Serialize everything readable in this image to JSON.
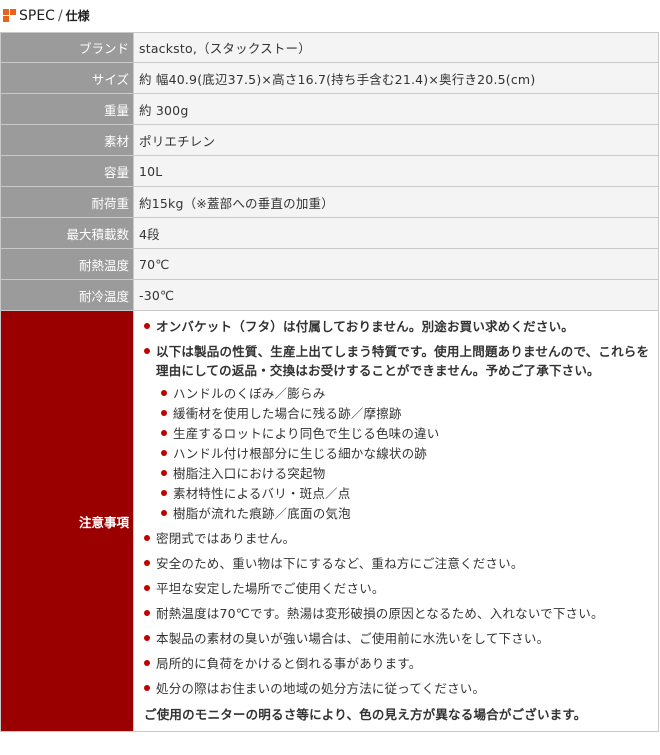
{
  "header": {
    "title": "SPEC",
    "title_ja": "仕様"
  },
  "spec_rows": [
    {
      "label": "ブランド",
      "value": "stacksto,（スタックストー）"
    },
    {
      "label": "サイズ",
      "value": "約 幅40.9(底辺37.5)×高さ16.7(持ち手含む21.4)×奥行き20.5(cm)"
    },
    {
      "label": "重量",
      "value": "約 300g"
    },
    {
      "label": "素材",
      "value": "ポリエチレン"
    },
    {
      "label": "容量",
      "value": "10L"
    },
    {
      "label": "耐荷重",
      "value": "約15kg（※蓋部への垂直の加重）"
    },
    {
      "label": "最大積載数",
      "value": "4段"
    },
    {
      "label": "耐熱温度",
      "value": "70℃"
    },
    {
      "label": "耐冷温度",
      "value": "-30℃"
    }
  ],
  "notice": {
    "label": "注意事項",
    "items": [
      "オンバケット（フタ）は付属しておりません。別途お買い求めください。",
      "以下は製品の性質、生産上出てしまう特質です。使用上問題ありませんので、これらを理由にしての返品・交換はお受けすることができません。予めご了承下さい。",
      "密閉式ではありません。",
      "安全のため、重い物は下にするなど、重ね方にご注意ください。",
      "平坦な安定した場所でご使用ください。",
      "耐熱温度は70℃です。熱湯は変形破損の原因となるため、入れないで下さい。",
      "本製品の素材の臭いが強い場合は、ご使用前に水洗いをして下さい。",
      "局所的に負荷をかけると倒れる事があります。",
      "処分の際はお住まいの地域の処分方法に従ってください。"
    ],
    "sub_items": [
      "ハンドルのくぼみ／膨らみ",
      "緩衝材を使用した場合に残る跡／摩擦跡",
      "生産するロットにより同色で生じる色味の違い",
      "ハンドル付け根部分に生じる細かな線状の跡",
      "樹脂注入口における突起物",
      "素材特性によるバリ・斑点／点",
      "樹脂が流れた痕跡／底面の気泡"
    ],
    "footnote": "ご使用のモニターの明るさ等により、色の見え方が異なる場合がございます。"
  },
  "colors": {
    "accent": "#e8631c",
    "label_bg": "#9b9b9b",
    "notice_bg": "#9a0000",
    "bullet": "#c00000"
  }
}
